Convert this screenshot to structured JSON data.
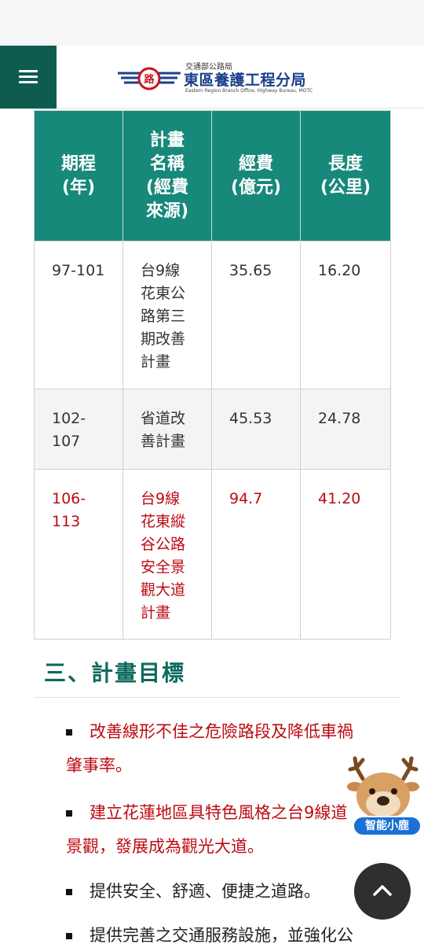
{
  "header": {
    "logo_small": "交通部公路局",
    "logo_main": "東區養護工程分局",
    "logo_en": "Eastern Region Branch Office, Highway Bureau, MOTC",
    "logo_emblem_char": "路"
  },
  "table": {
    "headers": [
      [
        "期程",
        "(年)"
      ],
      [
        "計畫",
        "名稱",
        "(經費",
        "來源)"
      ],
      [
        "經費",
        "(億元)"
      ],
      [
        "長度",
        "(公里)"
      ]
    ],
    "rows": [
      {
        "period": [
          "97-101"
        ],
        "name": [
          "台9線",
          "花東公",
          "路第三",
          "期改善",
          "計畫"
        ],
        "cost": "35.65",
        "length": "16.20"
      },
      {
        "period": [
          "102-",
          "107"
        ],
        "name": [
          "省道改",
          "善計畫"
        ],
        "cost": "45.53",
        "length": "24.78"
      },
      {
        "period": [
          "106-",
          "113"
        ],
        "name": [
          "台9線",
          "花東縱",
          "谷公路",
          "安全景",
          "觀大道",
          "計畫"
        ],
        "cost": "94.7",
        "length": "41.20"
      }
    ]
  },
  "section": {
    "title": "三、計畫目標"
  },
  "goals": [
    {
      "lines": [
        "改善線形不佳之危險路段及降低車禍",
        "肇事率。"
      ]
    },
    {
      "lines": [
        "建立花蓮地區具特色風格之台9線道",
        "景觀，發展成為觀光大道。"
      ]
    },
    {
      "lines": [
        "提供安全、舒適、便捷之道路。"
      ]
    },
    {
      "lines": [
        "提供完善之交通服務設施，並強化公"
      ]
    }
  ],
  "assistant": {
    "label": "智能小鹿"
  },
  "icons": {
    "menu": "hamburger-menu-icon",
    "back_to_top": "chevron-up-icon",
    "mascot": "deer-mascot-icon"
  },
  "colors": {
    "brand_green": "#0e5b50",
    "table_header": "#16897a",
    "highlight_red": "#bd0a12",
    "logo_blue": "#1a3f8a",
    "assistant_blue": "#1b6fd6"
  }
}
